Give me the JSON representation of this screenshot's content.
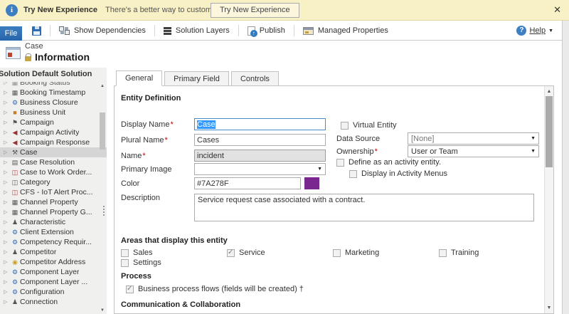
{
  "banner": {
    "title": "Try New Experience",
    "message": "There's a better way to customize the system",
    "button_label": "Try New Experience",
    "close": "✕"
  },
  "toolbar": {
    "file_label": "File",
    "buttons": [
      {
        "label": "Show Dependencies",
        "icon": "dependencies-icon"
      },
      {
        "label": "Solution Layers",
        "icon": "layers-icon"
      },
      {
        "label": "Publish",
        "icon": "publish-icon"
      },
      {
        "label": "Managed Properties",
        "icon": "managed-properties-icon"
      }
    ],
    "help_label": "Help",
    "help_caret": "▼"
  },
  "header": {
    "entity_name": "Case",
    "page_title": "Information"
  },
  "sidebar": {
    "solution_label": "Solution Default Solution",
    "tree": [
      {
        "label": "Booking Status",
        "icon": "grid-icon",
        "glyph": "▦",
        "icon_color": "#777777",
        "partial": true
      },
      {
        "label": "Booking Timestamp",
        "icon": "grid-icon",
        "glyph": "▦",
        "icon_color": "#555555"
      },
      {
        "label": "Business Closure",
        "icon": "gear-icon",
        "glyph": "⚙",
        "icon_color": "#2E6DB4"
      },
      {
        "label": "Business Unit",
        "icon": "briefcase-icon",
        "glyph": "■",
        "icon_color": "#C77B29"
      },
      {
        "label": "Campaign",
        "icon": "flag-icon",
        "glyph": "⚑",
        "icon_color": "#555555"
      },
      {
        "label": "Campaign Activity",
        "icon": "megaphone-icon",
        "glyph": "◀",
        "icon_color": "#993333"
      },
      {
        "label": "Campaign Response",
        "icon": "megaphone-icon",
        "glyph": "◀",
        "icon_color": "#993333"
      },
      {
        "label": "Case",
        "icon": "wrench-icon",
        "glyph": "⚒",
        "icon_color": "#555555",
        "selected": true
      },
      {
        "label": "Case Resolution",
        "icon": "chart-icon",
        "glyph": "▤",
        "icon_color": "#555555"
      },
      {
        "label": "Case to Work Order...",
        "icon": "org-chart-icon",
        "glyph": "◫",
        "icon_color": "#B03A3A"
      },
      {
        "label": "Category",
        "icon": "sitemap-icon",
        "glyph": "◫",
        "icon_color": "#555555"
      },
      {
        "label": "CFS - IoT Alert Proc...",
        "icon": "org-chart-icon",
        "glyph": "◫",
        "icon_color": "#B03A3A"
      },
      {
        "label": "Channel Property",
        "icon": "grid-icon",
        "glyph": "▦",
        "icon_color": "#555555"
      },
      {
        "label": "Channel Property G...",
        "icon": "grid-icon",
        "glyph": "▦",
        "icon_color": "#555555"
      },
      {
        "label": "Characteristic",
        "icon": "person-icon",
        "glyph": "♟",
        "icon_color": "#555555"
      },
      {
        "label": "Client Extension",
        "icon": "gear-icon",
        "glyph": "⚙",
        "icon_color": "#2E6DB4"
      },
      {
        "label": "Competency Requir...",
        "icon": "gear-icon",
        "glyph": "⚙",
        "icon_color": "#2E6DB4"
      },
      {
        "label": "Competitor",
        "icon": "people-icon",
        "glyph": "♟",
        "icon_color": "#555555"
      },
      {
        "label": "Competitor Address",
        "icon": "globe-icon",
        "glyph": "◉",
        "icon_color": "#C9A227"
      },
      {
        "label": "Component Layer",
        "icon": "gear-icon",
        "glyph": "⚙",
        "icon_color": "#2E6DB4"
      },
      {
        "label": "Component Layer ...",
        "icon": "gear-icon",
        "glyph": "⚙",
        "icon_color": "#2E6DB4"
      },
      {
        "label": "Configuration",
        "icon": "gear-icon",
        "glyph": "⚙",
        "icon_color": "#2E6DB4"
      },
      {
        "label": "Connection",
        "icon": "people-icon",
        "glyph": "♟",
        "icon_color": "#555555"
      }
    ]
  },
  "main": {
    "tabs": [
      {
        "label": "General",
        "active": true
      },
      {
        "label": "Primary Field",
        "active": false
      },
      {
        "label": "Controls",
        "active": false
      }
    ],
    "sections": {
      "entity_definition": "Entity Definition",
      "areas": "Areas that display this entity",
      "process": "Process",
      "communication": "Communication & Collaboration"
    },
    "fields": {
      "display_name": {
        "label": "Display Name",
        "required": "*",
        "value": "Case"
      },
      "plural_name": {
        "label": "Plural Name",
        "required": "*",
        "value": "Cases"
      },
      "name": {
        "label": "Name",
        "required": "*",
        "value": "incident"
      },
      "primary_image": {
        "label": "Primary Image",
        "value": ""
      },
      "color": {
        "label": "Color",
        "value": "#7A278F"
      },
      "description": {
        "label": "Description",
        "value": "Service request case associated with a contract."
      },
      "virtual_entity": {
        "label": "Virtual Entity",
        "checked": false
      },
      "data_source": {
        "label": "Data Source",
        "value": "[None]"
      },
      "ownership": {
        "label": "Ownership",
        "required": "*",
        "value": "User or Team"
      },
      "define_activity": {
        "label": "Define as an activity entity.",
        "checked": false
      },
      "display_activity_menus": {
        "label": "Display in Activity Menus",
        "checked": false
      }
    },
    "areas": [
      {
        "label": "Sales",
        "checked": false
      },
      {
        "label": "Service",
        "checked": true
      },
      {
        "label": "Marketing",
        "checked": false
      },
      {
        "label": "Training",
        "checked": false
      },
      {
        "label": "Settings",
        "checked": false
      }
    ],
    "process_flows": {
      "label": "Business process flows (fields will be created) †",
      "checked": true
    },
    "dropdown_caret": "▼"
  },
  "colors": {
    "accent_blue": "#2B6CB5",
    "banner_bg": "#F9F1C6",
    "required_red": "#C00000",
    "entity_color": "#7A278F",
    "selection_blue": "#3399FF"
  }
}
